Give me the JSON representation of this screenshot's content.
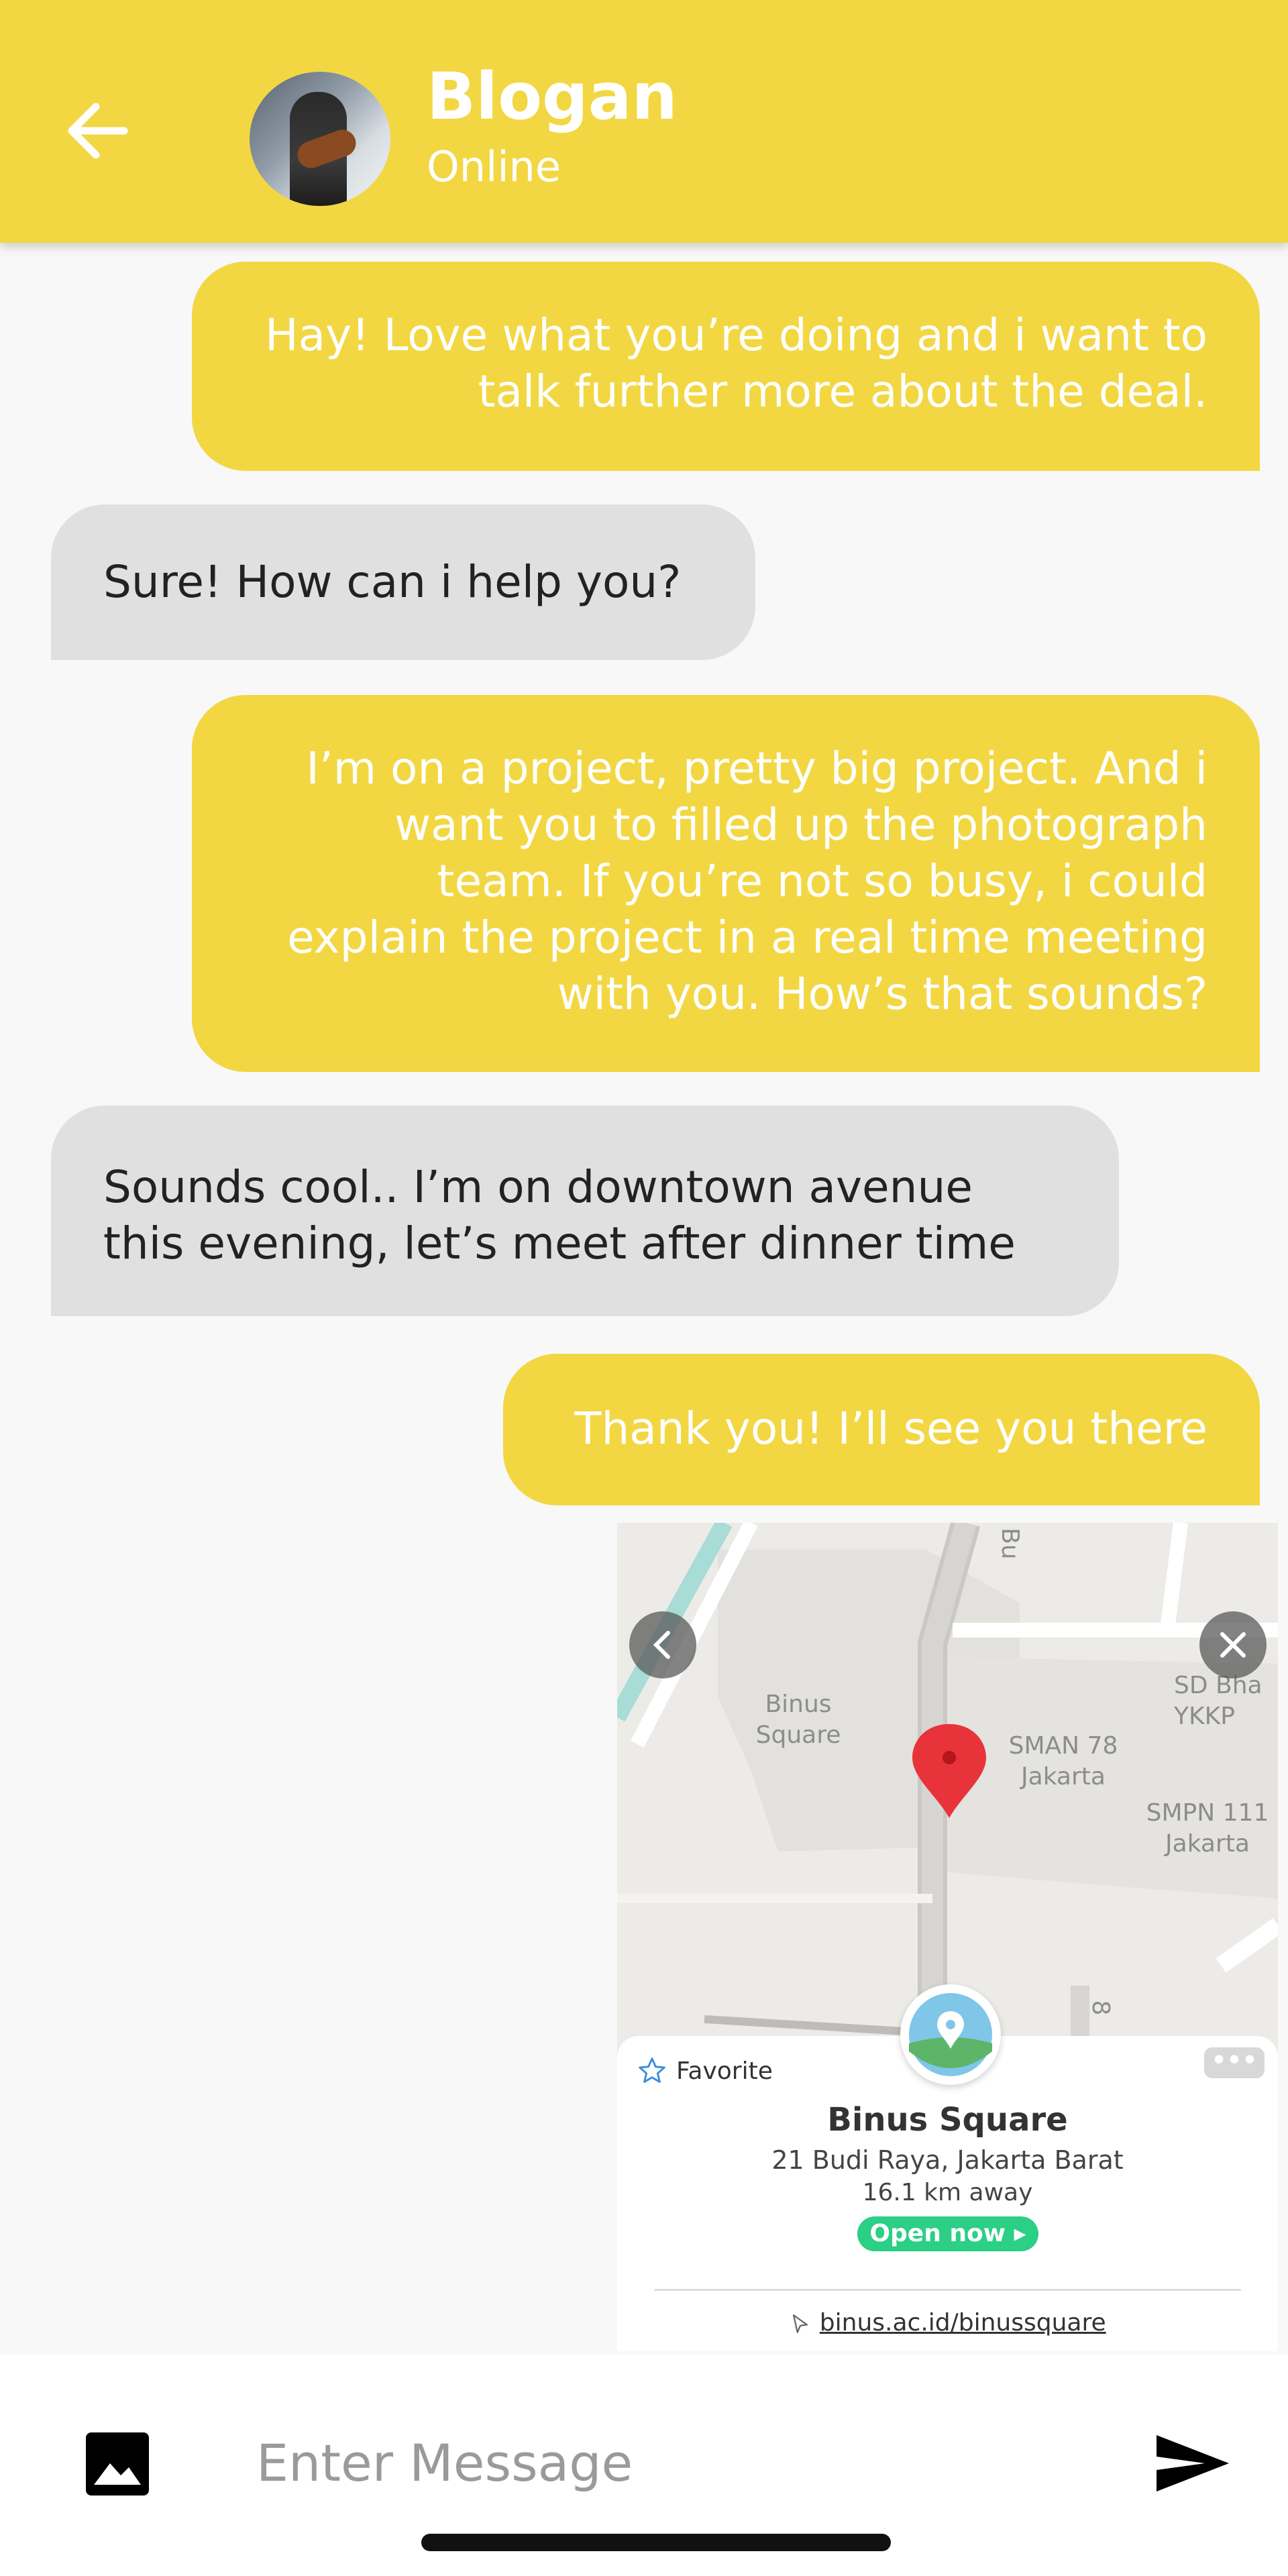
{
  "header": {
    "title": "Blogan",
    "status": "Online",
    "back_icon": "arrow-left-icon",
    "avatar": "profile-photo"
  },
  "messages": [
    {
      "direction": "outgoing",
      "text": "Hay! Love what you’re doing and i want to\ntalk further more about the deal."
    },
    {
      "direction": "incoming",
      "text": "Sure! How can i help you?"
    },
    {
      "direction": "outgoing",
      "text": "I’m on a project, pretty big project. And i\nwant you to filled up the photograph\nteam. If you’re not so busy, i could\nexplain the project in a real time meeting\nwith you. How’s that sounds?"
    },
    {
      "direction": "incoming",
      "text": "Sounds cool.. I’m on downtown avenue\nthis evening, let’s meet after dinner time"
    },
    {
      "direction": "outgoing",
      "text": "Thank you! I’ll see you there"
    }
  ],
  "map_card": {
    "labels": {
      "binus_square": "Binus\nSquare",
      "sman78": "SMAN 78\nJakarta",
      "sd": "SD Bha\nYKKP",
      "smpn111": "SMPN 111\nJakarta",
      "road_top": "Bu",
      "road_bottom": "8"
    },
    "favorite_label": "Favorite",
    "more_label": "•••",
    "place_name": "Binus Square",
    "address": "21 Budi Raya, Jakarta Barat",
    "distance": "16.1 km away",
    "open_status": "Open now ▸",
    "link": "binus.ac.id/binussquare"
  },
  "input": {
    "placeholder": "Enter Message"
  },
  "colors": {
    "accent": "#f2d743",
    "incoming_bubble": "#e0e0e0",
    "open_badge": "#2bcf85",
    "map_pin": "#e8333a"
  }
}
